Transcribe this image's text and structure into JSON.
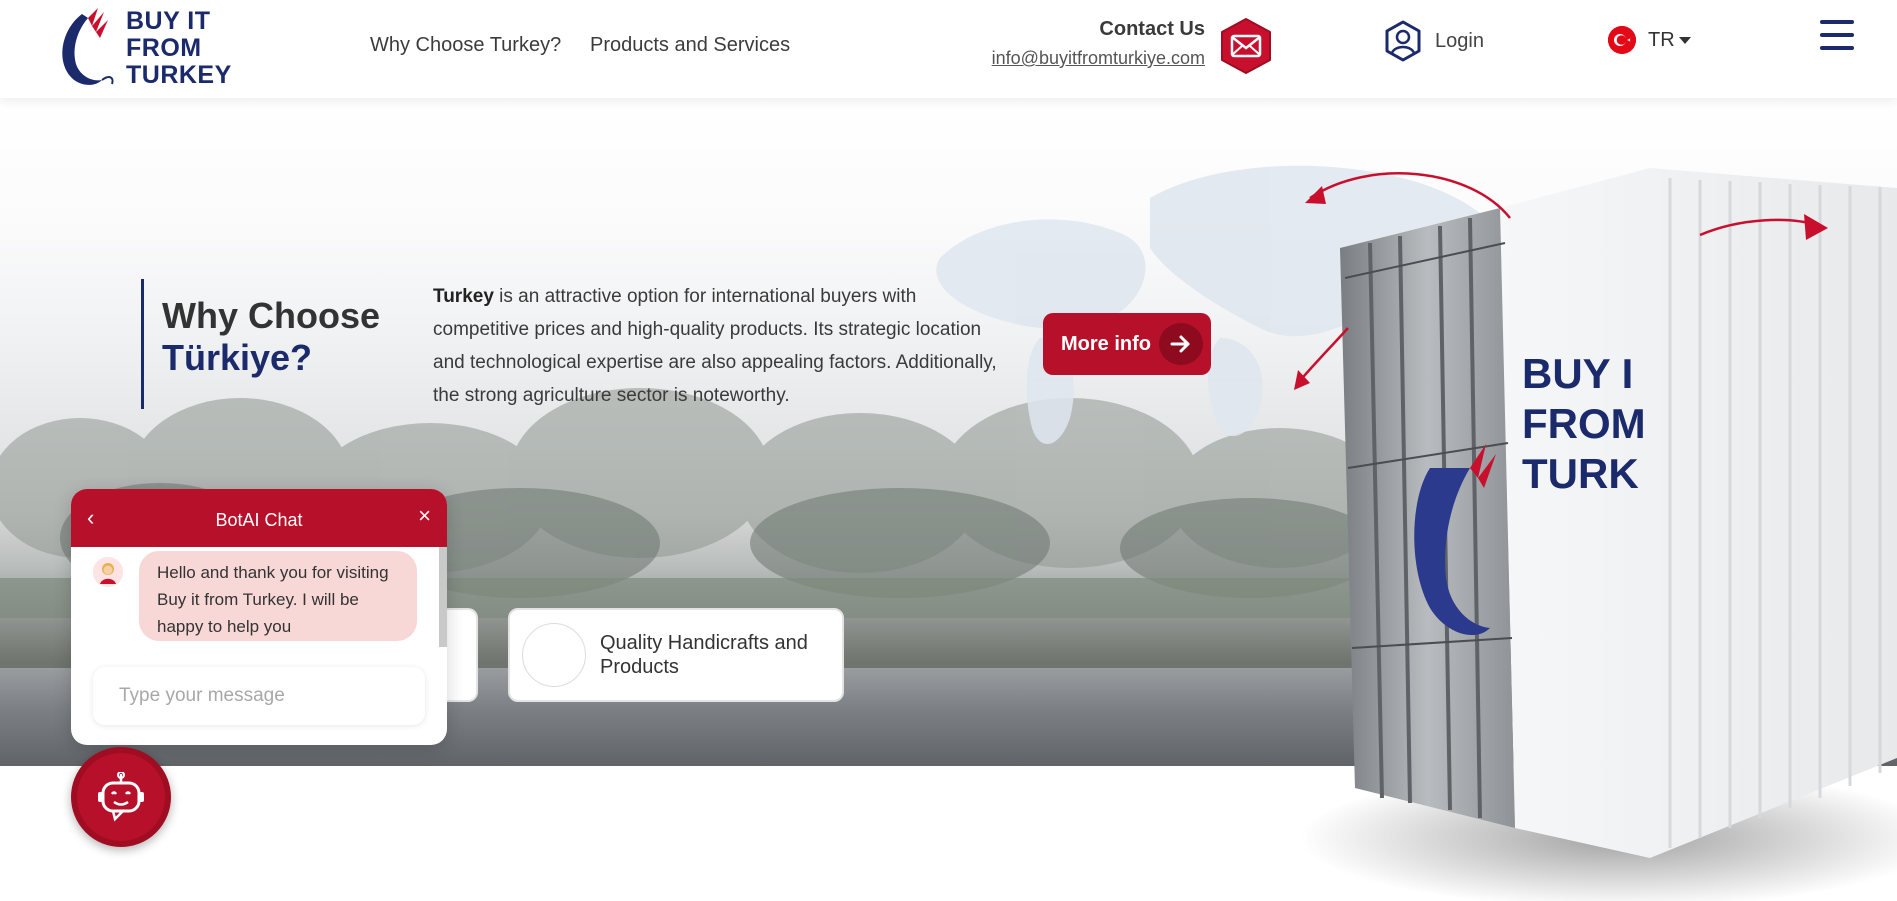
{
  "brand": {
    "logo_line1": "BUY IT",
    "logo_line2": "FROM",
    "logo_line3": "TURKEY",
    "primary_color": "#b7102a",
    "navy_color": "#1b2a6b"
  },
  "nav": {
    "why_label": "Why Choose Turkey?",
    "products_label": "Products and Services"
  },
  "contact": {
    "title": "Contact Us",
    "email": "info@buyitfromturkiye.com",
    "icon": "mail-icon"
  },
  "login": {
    "label": "Login",
    "icon": "user-circle-icon"
  },
  "language": {
    "code": "TR",
    "icon": "turkey-flag-icon"
  },
  "menu": {
    "icon": "hamburger-menu-icon"
  },
  "hero": {
    "title_line1": "Why Choose",
    "title_line2": "Türkiye?",
    "intro_bold": "Turkey",
    "intro_text": " is an attractive option for international buyers with competitive prices and high-quality products. Its strategic location and technological expertise are also appealing factors. Additionally, the strong agriculture sector is noteworthy.",
    "more_button": "More info",
    "container_logo_line1": "BUY I",
    "container_logo_line2": "FROM",
    "container_logo_line3": "TURK"
  },
  "cards": [
    {
      "label": "Quality Handicrafts and Products"
    }
  ],
  "chat": {
    "title": "BotAI Chat",
    "back_icon": "chevron-left-icon",
    "close_icon": "close-icon",
    "message": "Hello and thank you for visiting Buy it from Turkey. I will be happy to help you",
    "input_placeholder": "Type your message",
    "fab_icon": "chatbot-icon"
  }
}
